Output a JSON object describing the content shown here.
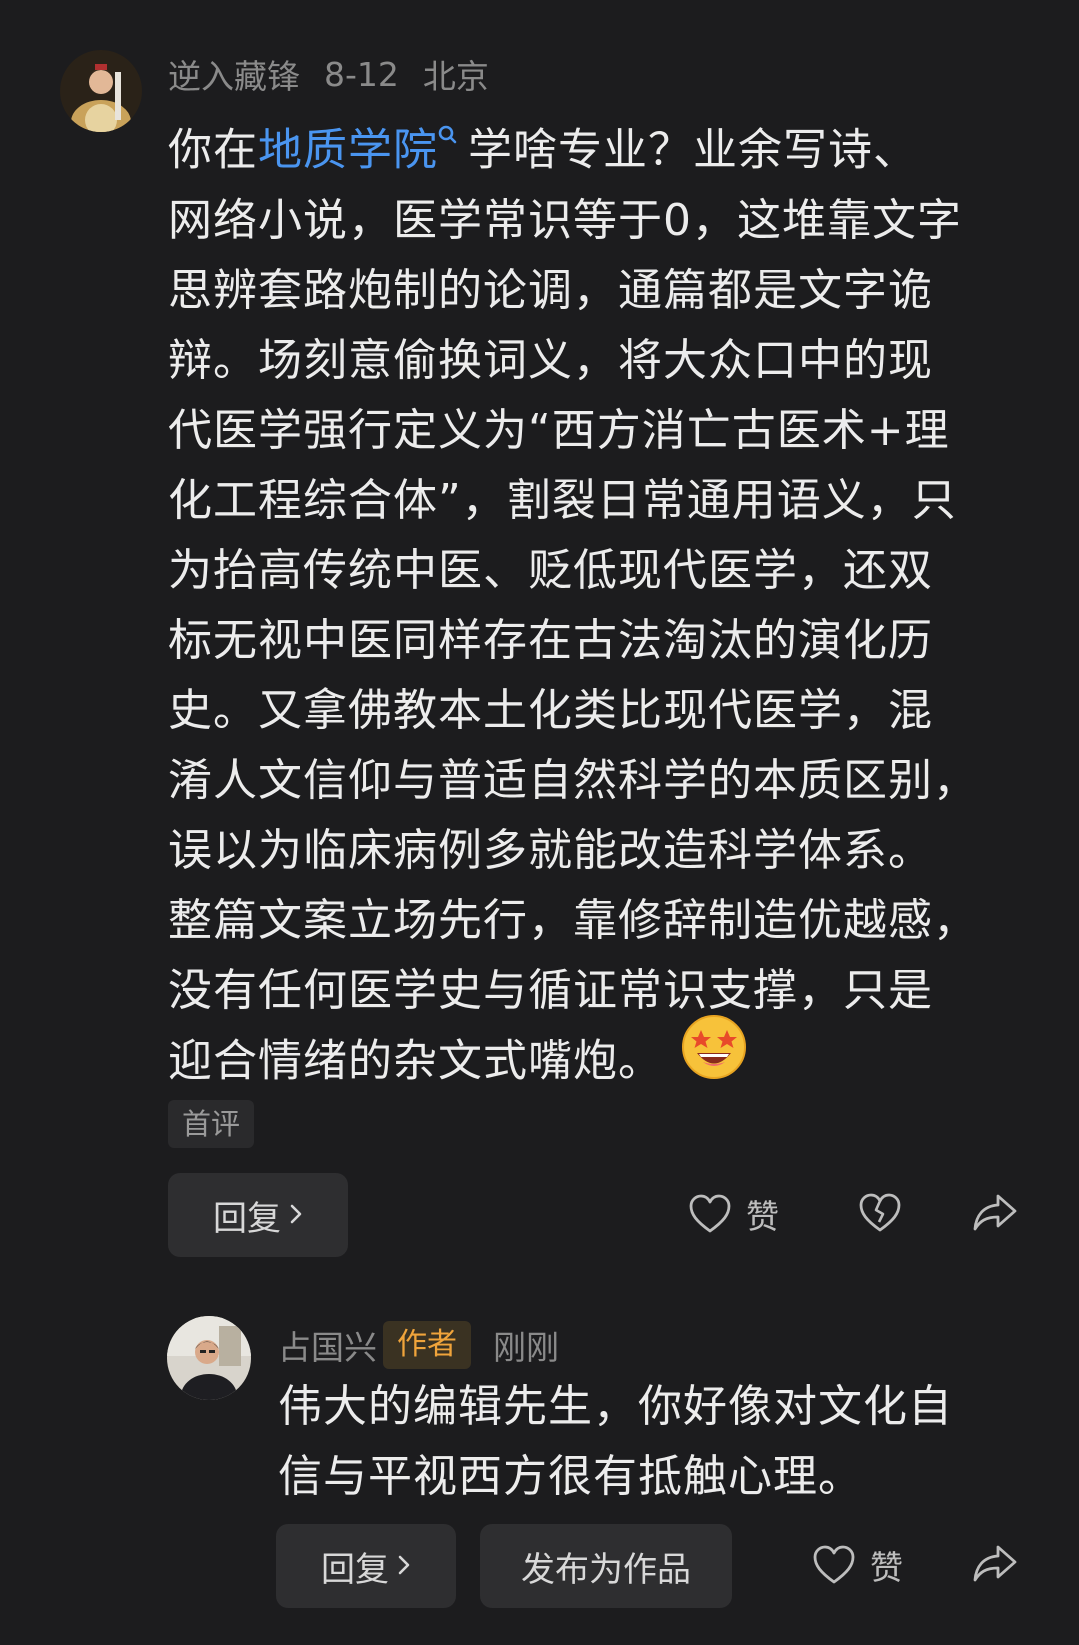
{
  "comment": {
    "username": "逆入藏锋",
    "date": "8-12",
    "location": "北京",
    "body_line1_before": "你在",
    "body_link": "地质学院",
    "body_link_icon": "search-icon",
    "body_line1_after": "学啥专业？业余写诗、",
    "body_lines": [
      "网络小说，医学常识等于0，这堆靠文字",
      "思辨套路炮制的论调，通篇都是文字诡",
      "辩。场刻意偷换词义，将大众口中的现",
      "代医学强行定义为“西方消亡古医术+理",
      "化工程综合体”，割裂日常通用语义，只",
      "为抬高传统中医、贬低现代医学，还双",
      "标无视中医同样存在古法淘汰的演化历",
      "史。又拿佛教本土化类比现代医学，混",
      "淆人文信仰与普适自然科学的本质区别，",
      "误以为临床病例多就能改造科学体系。",
      "整篇文案立场先行，靠修辞制造优越感，",
      "没有任何医学史与循证常识支撑，只是"
    ],
    "body_last_line": "迎合情绪的杂文式嘴炮。",
    "emoji": "star-struck-emoji",
    "tag": "首评",
    "reply_label": "回复",
    "like_label": "赞"
  },
  "reply": {
    "username": "占国兴",
    "author_badge": "作者",
    "time": "刚刚",
    "body_lines": [
      "伟大的编辑先生，你好像对文化自",
      "信与平视西方很有抵触心理。"
    ],
    "reply_label": "回复",
    "publish_label": "发布为作品",
    "like_label": "赞"
  },
  "colors": {
    "background": "#1c1c1e",
    "link": "#4a95f0",
    "author_badge_text": "#f0a43b",
    "author_badge_bg": "#3a3222",
    "meta_text": "#8a8a8a"
  }
}
